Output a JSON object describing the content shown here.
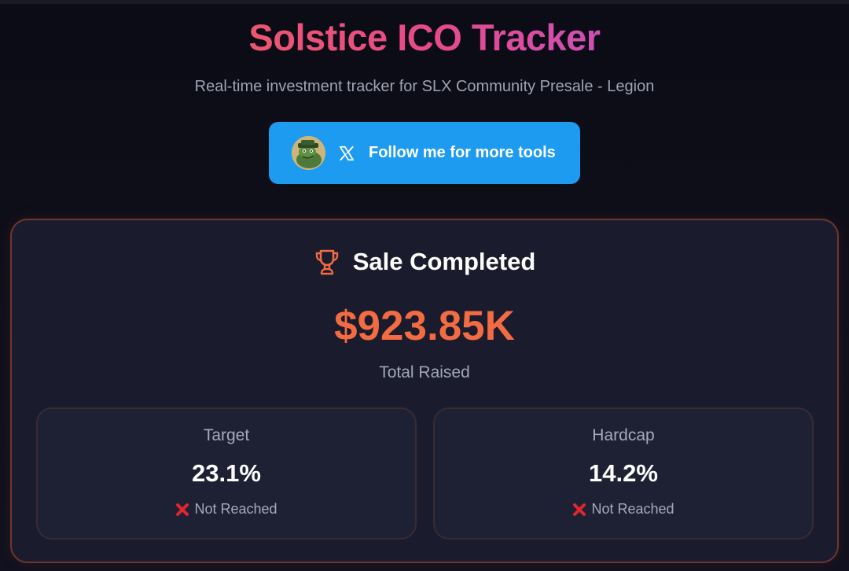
{
  "header": {
    "title": "Solstice ICO Tracker",
    "subtitle": "Real-time investment tracker for SLX Community Presale - Legion"
  },
  "follow_button": {
    "label": "Follow me for more tools",
    "icon": "x-logo-icon",
    "color": "#1d9bf0"
  },
  "sale": {
    "status": "Sale Completed",
    "status_icon": "trophy-icon",
    "total_raised": "$923.85K",
    "total_caption": "Total Raised",
    "accent_color": "#f26b42"
  },
  "stats": [
    {
      "label": "Target",
      "value": "23.1%",
      "status": "Not Reached",
      "status_icon": "cross-mark-icon"
    },
    {
      "label": "Hardcap",
      "value": "14.2%",
      "status": "Not Reached",
      "status_icon": "cross-mark-icon"
    }
  ]
}
